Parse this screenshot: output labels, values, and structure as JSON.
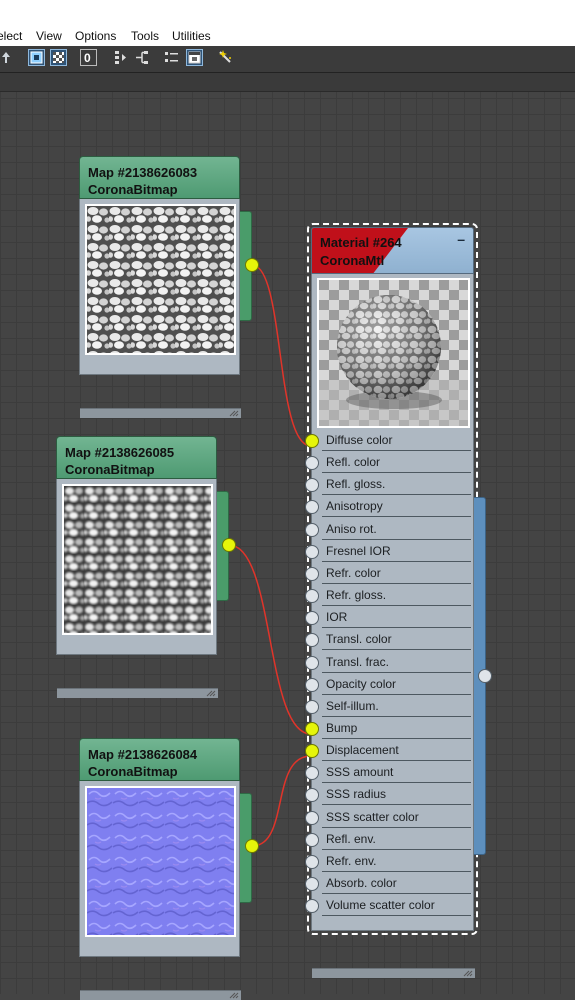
{
  "menubar": {
    "items": [
      "elect",
      "View",
      "Options",
      "Tools",
      "Utilities"
    ]
  },
  "toolbar": {
    "buttons": [
      "move-children-icon",
      "show-background-icon",
      "background-checker-icon",
      "zero-icon",
      "layout-icon",
      "layout-children-icon",
      "show-all-icon",
      "preview-icon",
      "magic-wand-icon"
    ]
  },
  "nodes": {
    "map1": {
      "title": "Map #2138626083",
      "type": "CoronaBitmap",
      "texture": "white-pebbles"
    },
    "map2": {
      "title": "Map #2138626085",
      "type": "CoronaBitmap",
      "texture": "grayscale-pebbles"
    },
    "map3": {
      "title": "Map #2138626084",
      "type": "CoronaBitmap",
      "texture": "normal-map"
    },
    "material": {
      "title": "Material #264",
      "type": "CoronaMtl",
      "minimize": "–",
      "slots": [
        "Diffuse color",
        "Refl. color",
        "Refl. gloss.",
        "Anisotropy",
        "Aniso rot.",
        "Fresnel IOR",
        "Refr. color",
        "Refr. gloss.",
        "IOR",
        "Transl. color",
        "Transl. frac.",
        "Opacity color",
        "Self-illum.",
        "Bump",
        "Displacement",
        "SSS amount",
        "SSS radius",
        "SSS scatter color",
        "Refl. env.",
        "Refr. env.",
        "Absorb. color",
        "Volume scatter color"
      ],
      "connected_slots": [
        "Diffuse color",
        "Bump",
        "Displacement"
      ]
    }
  },
  "connections": [
    {
      "from": "Map #2138626083",
      "to": "Diffuse color"
    },
    {
      "from": "Map #2138626085",
      "to": "Bump"
    },
    {
      "from": "Map #2138626084",
      "to": "Displacement"
    }
  ],
  "colors": {
    "map_header": "#5fa882",
    "material_header": "#9bbcd9",
    "material_header_accent": "#c0101a",
    "wire": "#e0342a",
    "socket_connected": "#e6f50a"
  }
}
